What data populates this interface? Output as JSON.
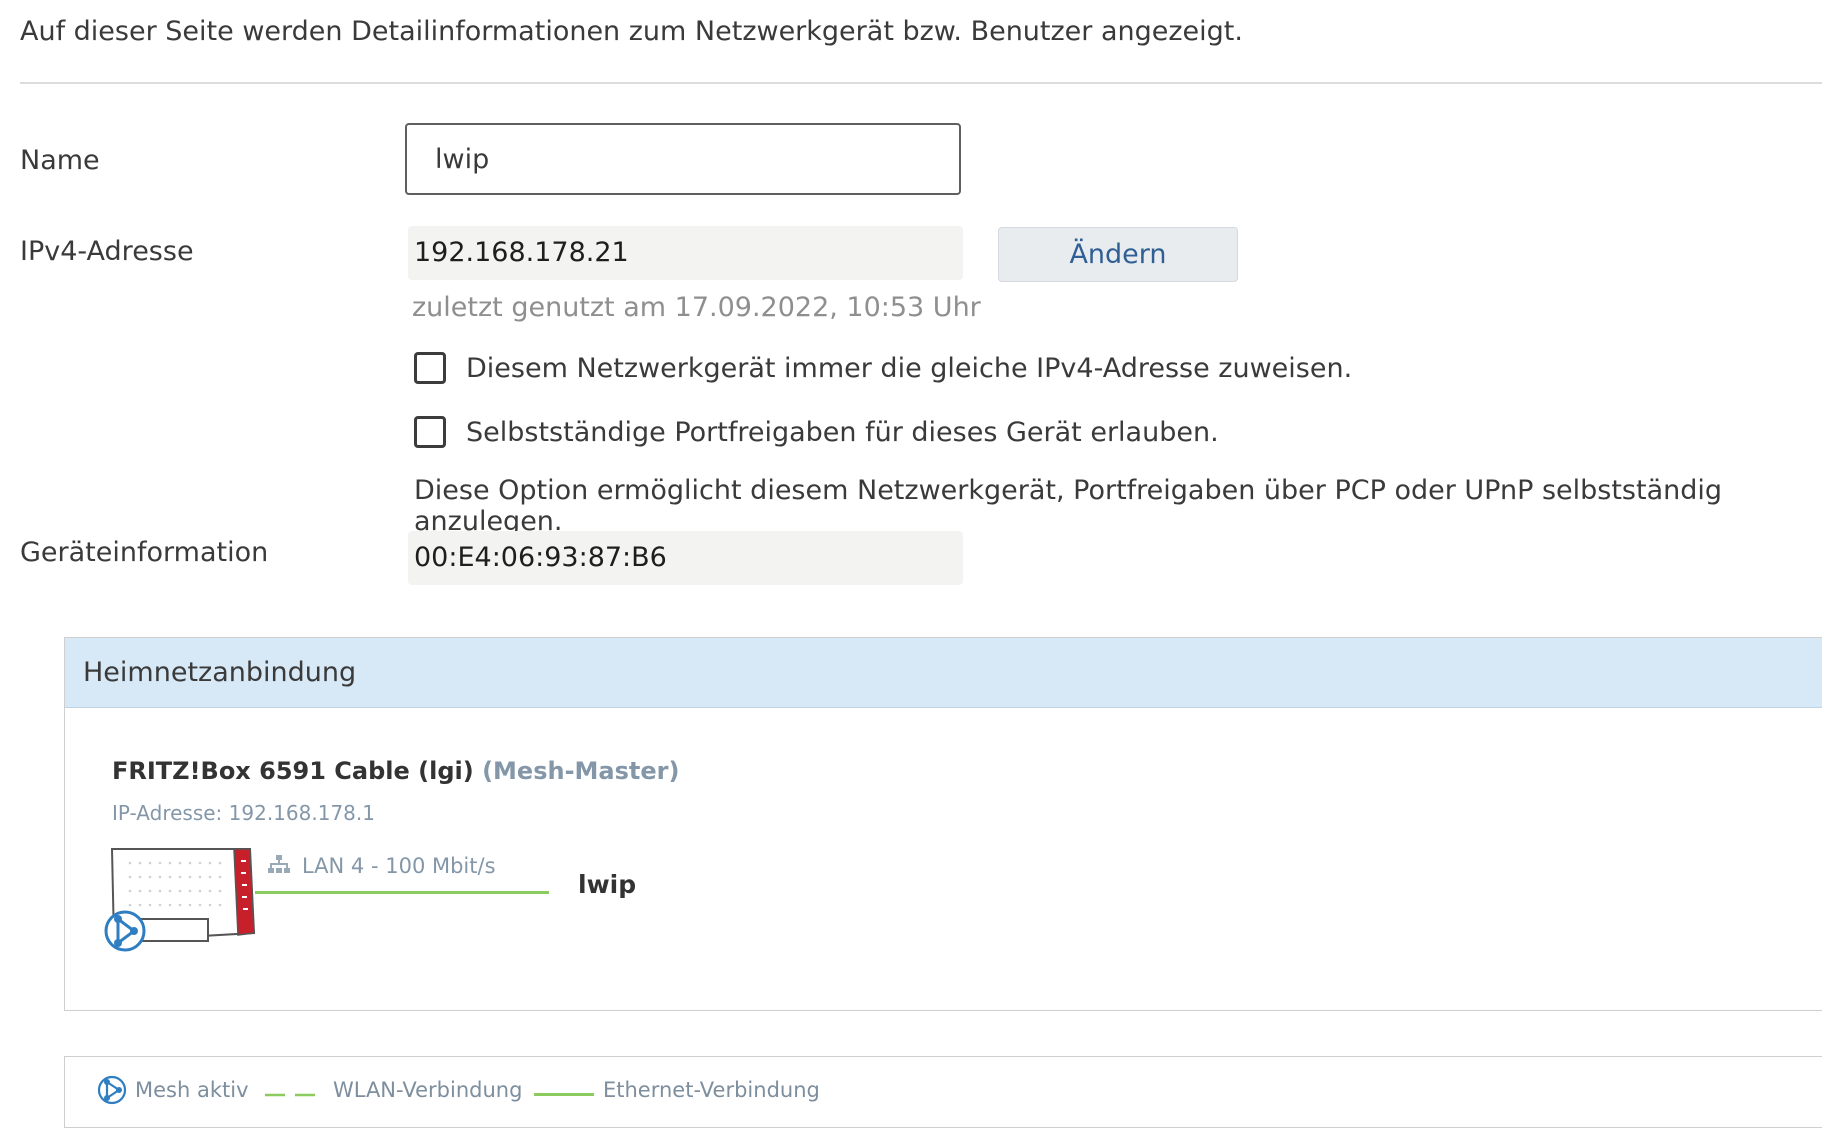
{
  "intro": "Auf dieser Seite werden Detailinformationen zum Netzwerkgerät bzw. Benutzer angezeigt.",
  "name": {
    "label": "Name",
    "value": "lwip"
  },
  "ipv4": {
    "label": "IPv4-Adresse",
    "value": "192.168.178.21",
    "change_button": "Ändern",
    "last_used": "zuletzt genutzt am 17.09.2022, 10:53 Uhr"
  },
  "options": {
    "static_ip": {
      "label": "Diesem Netzwerkgerät immer die gleiche IPv4-Adresse zuweisen.",
      "checked": false
    },
    "port_forward": {
      "label": "Selbstständige Portfreigaben für dieses Gerät erlauben.",
      "checked": false
    },
    "port_forward_desc": "Diese Option ermöglicht diesem Netzwerkgerät, Portfreigaben über PCP oder UPnP selbstständig anzulegen."
  },
  "device_info": {
    "label": "Geräteinformation",
    "value": "00:E4:06:93:87:B6"
  },
  "heimnetz": {
    "title": "Heimnetzanbindung",
    "device_name": "FRITZ!Box 6591 Cable (lgi)",
    "device_role": "(Mesh-Master)",
    "device_ip": "IP-Adresse: 192.168.178.1",
    "connection": "LAN 4 - 100 Mbit/s",
    "client": "lwip"
  },
  "legend": {
    "mesh": "Mesh aktiv",
    "wlan": "WLAN-Verbindung",
    "ethernet": "Ethernet-Verbindung"
  },
  "colors": {
    "accent_blue": "#2f7ec1",
    "ethernet_green": "#8ccb5e",
    "panel_header": "#d7e8f6",
    "fritz_red": "#c8202b"
  }
}
